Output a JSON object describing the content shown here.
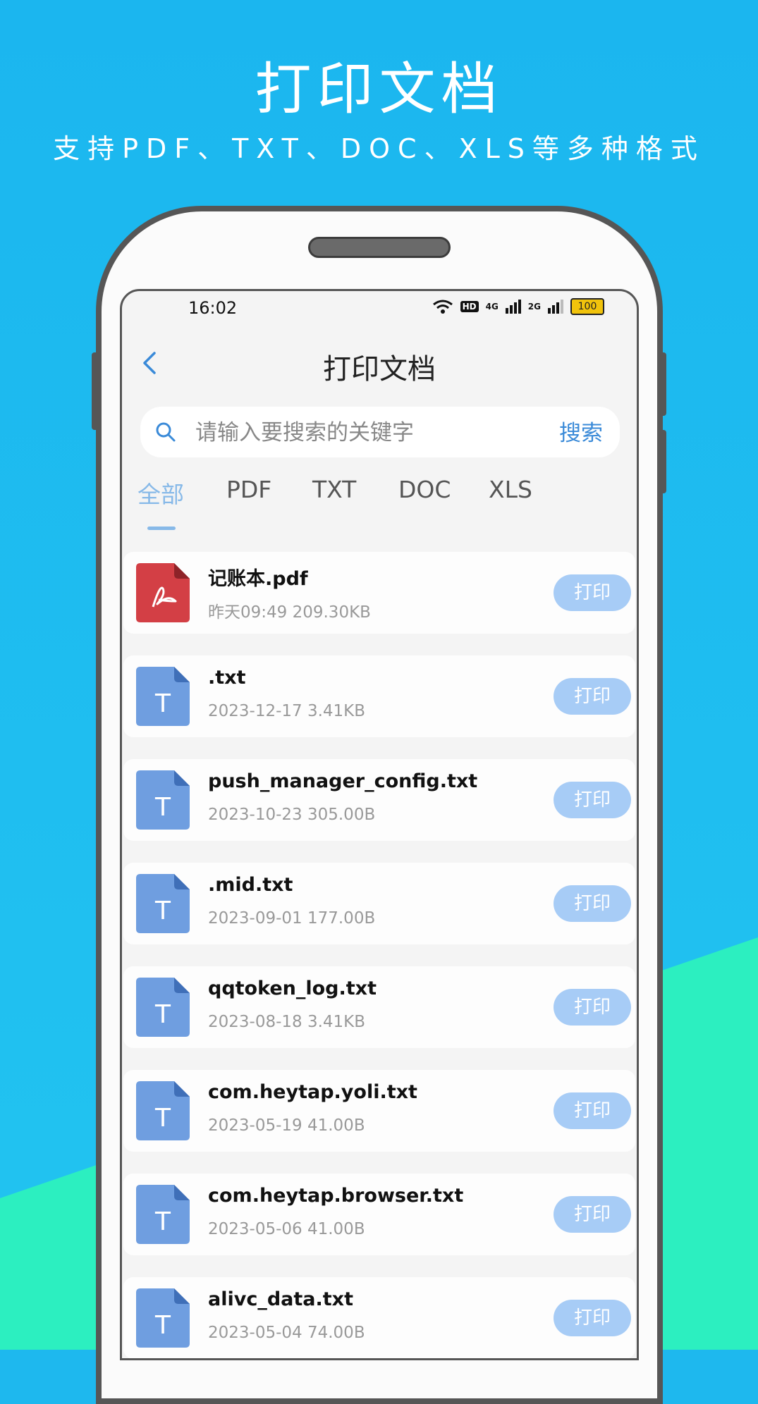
{
  "promo": {
    "title": "打印文档",
    "subtitle": "支持PDF、TXT、DOC、XLS等多种格式"
  },
  "status_bar": {
    "time": "16:02",
    "hd_badge": "HD",
    "net_4g": "4G",
    "net_2g": "2G",
    "battery": "100"
  },
  "nav": {
    "title": "打印文档"
  },
  "search": {
    "placeholder": "请输入要搜索的关键字",
    "button_label": "搜索"
  },
  "tabs": [
    "全部",
    "PDF",
    "TXT",
    "DOC",
    "XLS"
  ],
  "active_tab": "全部",
  "files": [
    {
      "name": "记账本.pdf",
      "meta": "昨天09:49 209.30KB",
      "type": "pdf",
      "print_label": "打印"
    },
    {
      "name": ".txt",
      "meta": "2023-12-17 3.41KB",
      "type": "txt",
      "print_label": "打印"
    },
    {
      "name": "push_manager_config.txt",
      "meta": "2023-10-23 305.00B",
      "type": "txt",
      "print_label": "打印"
    },
    {
      "name": ".mid.txt",
      "meta": "2023-09-01 177.00B",
      "type": "txt",
      "print_label": "打印"
    },
    {
      "name": "qqtoken_log.txt",
      "meta": "2023-08-18 3.41KB",
      "type": "txt",
      "print_label": "打印"
    },
    {
      "name": "com.heytap.yoli.txt",
      "meta": "2023-05-19 41.00B",
      "type": "txt",
      "print_label": "打印"
    },
    {
      "name": "com.heytap.browser.txt",
      "meta": "2023-05-06 41.00B",
      "type": "txt",
      "print_label": "打印"
    },
    {
      "name": "alivc_data.txt",
      "meta": "2023-05-04 74.00B",
      "type": "txt",
      "print_label": "打印"
    }
  ],
  "icons": {
    "txt_letter": "T",
    "txt_color": "#6f9ee0",
    "pdf_color": "#d33f45"
  },
  "colors": {
    "background_top": "#1eb8ee",
    "background_bottom": "#2df0bc",
    "accent": "#3a8ad8",
    "tab_active": "#87b9e8",
    "print_button": "#a7ccf6"
  }
}
